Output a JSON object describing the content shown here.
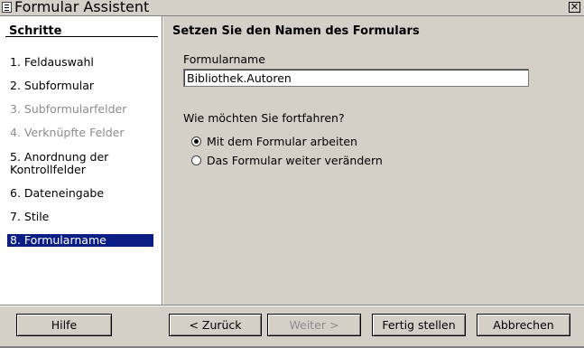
{
  "window": {
    "title": "Formular Assistent",
    "close_glyph": "✕"
  },
  "sidebar": {
    "header": "Schritte",
    "steps": [
      {
        "label": "1. Feldauswahl",
        "state": "enabled"
      },
      {
        "label": "2. Subformular",
        "state": "enabled"
      },
      {
        "label": "3. Subformularfelder",
        "state": "disabled"
      },
      {
        "label": "4. Verknüpfte Felder",
        "state": "disabled"
      },
      {
        "label": "5. Anordnung der\nKontrollfelder",
        "state": "enabled"
      },
      {
        "label": "6. Dateneingabe",
        "state": "enabled"
      },
      {
        "label": "7. Stile",
        "state": "enabled"
      },
      {
        "label": "8. Formularname",
        "state": "selected"
      }
    ]
  },
  "main": {
    "title": "Setzen Sie den Namen des Formulars",
    "name_label": "Formularname",
    "name_value": "Bibliothek.Autoren",
    "question": "Wie möchten Sie fortfahren?",
    "options": [
      {
        "label": "Mit dem Formular arbeiten",
        "checked": true
      },
      {
        "label": "Das Formular weiter verändern",
        "checked": false
      }
    ]
  },
  "buttons": {
    "help": "Hilfe",
    "back": "< Zurück",
    "next": "Weiter >",
    "finish": "Fertig stellen",
    "cancel": "Abbrechen"
  },
  "colors": {
    "selection": "#0a1e84",
    "dialog_bg": "#d4d0c8",
    "disabled_text": "#8c8c8c"
  }
}
